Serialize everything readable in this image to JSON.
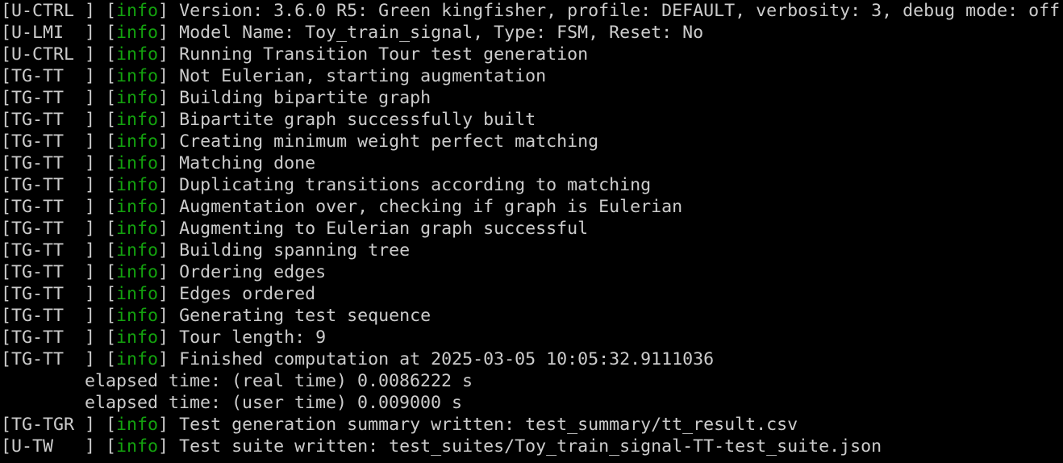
{
  "colors": {
    "background": "#000000",
    "text": "#cccccc",
    "info": "#13a10e"
  },
  "terminal": {
    "lines": [
      {
        "type": "log",
        "module": "[U-CTRL ] ",
        "open": "[",
        "level": "info",
        "close": "] ",
        "message": "Version: 3.6.0 R5: Green kingfisher, profile: DEFAULT, verbosity: 3, debug mode: off"
      },
      {
        "type": "log",
        "module": "[U-LMI  ] ",
        "open": "[",
        "level": "info",
        "close": "] ",
        "message": "Model Name: Toy_train_signal, Type: FSM, Reset: No"
      },
      {
        "type": "log",
        "module": "[U-CTRL ] ",
        "open": "[",
        "level": "info",
        "close": "] ",
        "message": "Running Transition Tour test generation"
      },
      {
        "type": "log",
        "module": "[TG-TT  ] ",
        "open": "[",
        "level": "info",
        "close": "] ",
        "message": "Not Eulerian, starting augmentation"
      },
      {
        "type": "log",
        "module": "[TG-TT  ] ",
        "open": "[",
        "level": "info",
        "close": "] ",
        "message": "Building bipartite graph"
      },
      {
        "type": "log",
        "module": "[TG-TT  ] ",
        "open": "[",
        "level": "info",
        "close": "] ",
        "message": "Bipartite graph successfully built"
      },
      {
        "type": "log",
        "module": "[TG-TT  ] ",
        "open": "[",
        "level": "info",
        "close": "] ",
        "message": "Creating minimum weight perfect matching"
      },
      {
        "type": "log",
        "module": "[TG-TT  ] ",
        "open": "[",
        "level": "info",
        "close": "] ",
        "message": "Matching done"
      },
      {
        "type": "log",
        "module": "[TG-TT  ] ",
        "open": "[",
        "level": "info",
        "close": "] ",
        "message": "Duplicating transitions according to matching"
      },
      {
        "type": "log",
        "module": "[TG-TT  ] ",
        "open": "[",
        "level": "info",
        "close": "] ",
        "message": "Augmentation over, checking if graph is Eulerian"
      },
      {
        "type": "log",
        "module": "[TG-TT  ] ",
        "open": "[",
        "level": "info",
        "close": "] ",
        "message": "Augmenting to Eulerian graph successful"
      },
      {
        "type": "log",
        "module": "[TG-TT  ] ",
        "open": "[",
        "level": "info",
        "close": "] ",
        "message": "Building spanning tree"
      },
      {
        "type": "log",
        "module": "[TG-TT  ] ",
        "open": "[",
        "level": "info",
        "close": "] ",
        "message": "Ordering edges"
      },
      {
        "type": "log",
        "module": "[TG-TT  ] ",
        "open": "[",
        "level": "info",
        "close": "] ",
        "message": "Edges ordered"
      },
      {
        "type": "log",
        "module": "[TG-TT  ] ",
        "open": "[",
        "level": "info",
        "close": "] ",
        "message": "Generating test sequence"
      },
      {
        "type": "log",
        "module": "[TG-TT  ] ",
        "open": "[",
        "level": "info",
        "close": "] ",
        "message": "Tour length: 9"
      },
      {
        "type": "log",
        "module": "[TG-TT  ] ",
        "open": "[",
        "level": "info",
        "close": "] ",
        "message": "Finished computation at 2025-03-05 10:05:32.9111036"
      },
      {
        "type": "plain",
        "text": "        elapsed time: (real time) 0.0086222 s"
      },
      {
        "type": "plain",
        "text": "        elapsed time: (user time) 0.009000 s"
      },
      {
        "type": "log",
        "module": "[TG-TGR ] ",
        "open": "[",
        "level": "info",
        "close": "] ",
        "message": "Test generation summary written: test_summary/tt_result.csv"
      },
      {
        "type": "log",
        "module": "[U-TW   ] ",
        "open": "[",
        "level": "info",
        "close": "] ",
        "message": "Test suite written: test_suites/Toy_train_signal-TT-test_suite.json"
      }
    ]
  }
}
